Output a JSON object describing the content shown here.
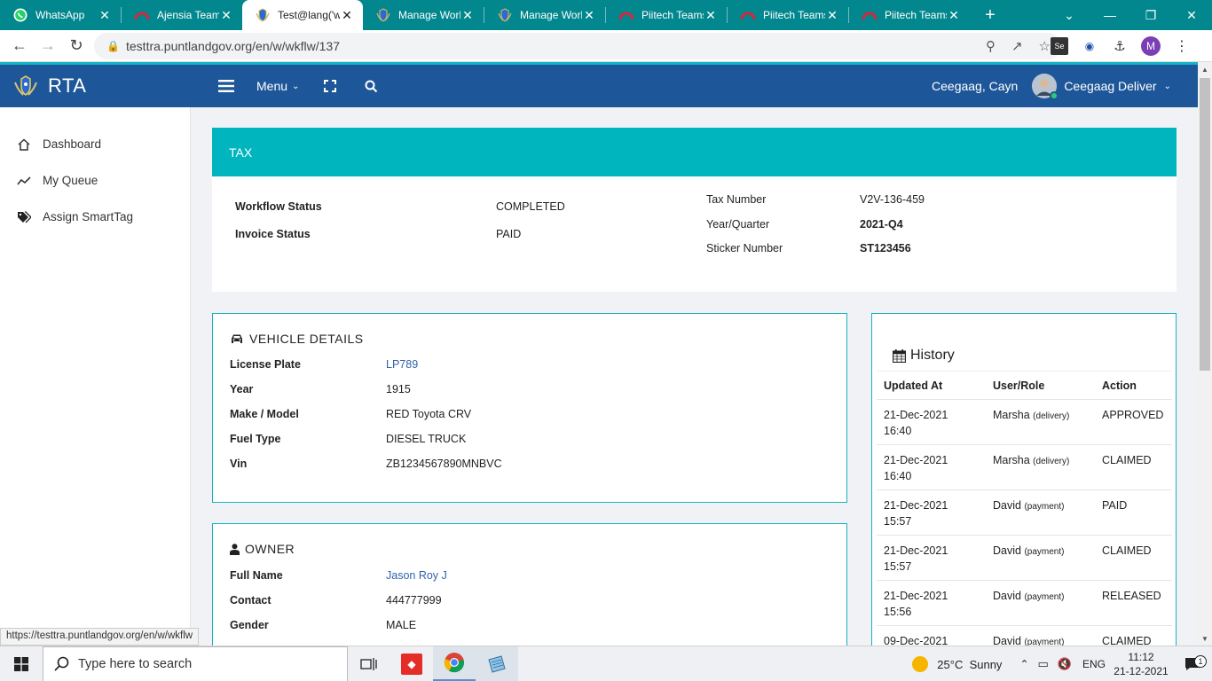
{
  "browser": {
    "tabs": [
      {
        "title": "WhatsApp",
        "favicon": "whatsapp-icon",
        "active": false
      },
      {
        "title": "Ajensia Team",
        "favicon": "teams-ring-icon",
        "active": false
      },
      {
        "title": "Test@lang('w",
        "favicon": "rta-crest-icon",
        "active": true
      },
      {
        "title": "Manage Worl",
        "favicon": "rta-crest-icon",
        "active": false
      },
      {
        "title": "Manage Worl",
        "favicon": "rta-crest-icon",
        "active": false
      },
      {
        "title": "Piitech Teams",
        "favicon": "teams-ring-icon",
        "active": false
      },
      {
        "title": "Piitech Teams",
        "favicon": "teams-ring-icon",
        "active": false
      },
      {
        "title": "Piitech Teams",
        "favicon": "teams-ring-icon",
        "active": false
      }
    ],
    "url": "testtra.puntlandgov.org/en/w/wkflw/137",
    "profile_initial": "M",
    "status_url": "https://testtra.puntlandgov.org/en/w/wkflw",
    "colors": {
      "tabbar": "#02878e",
      "header": "#1e5799",
      "accent": "#00b5bd"
    }
  },
  "header": {
    "brand": "RTA",
    "menu_label": "Menu",
    "user_short": "Ceegaag, Cayn",
    "user_role": "Ceegaag Deliver"
  },
  "sidebar": {
    "items": [
      {
        "label": "Dashboard",
        "icon": "home-icon"
      },
      {
        "label": "My Queue",
        "icon": "trend-line-icon"
      },
      {
        "label": "Assign SmartTag",
        "icon": "tags-icon"
      }
    ]
  },
  "tax": {
    "title": "TAX",
    "workflow_status_label": "Workflow Status",
    "workflow_status": "COMPLETED",
    "invoice_status_label": "Invoice Status",
    "invoice_status": "PAID",
    "tax_number_label": "Tax Number",
    "tax_number": "V2V-136-459",
    "year_quarter_label": "Year/Quarter",
    "year_quarter": "2021-Q4",
    "sticker_number_label": "Sticker Number",
    "sticker_number": "ST123456"
  },
  "vehicle": {
    "title": "VEHICLE DETAILS",
    "rows": [
      {
        "label": "License Plate",
        "value": "LP789"
      },
      {
        "label": "Year",
        "value": "1915"
      },
      {
        "label": "Make / Model",
        "value": "RED Toyota CRV"
      },
      {
        "label": "Fuel Type",
        "value": "DIESEL TRUCK"
      },
      {
        "label": "Vin",
        "value": "ZB1234567890MNBVC"
      }
    ]
  },
  "owner": {
    "title": "OWNER",
    "rows": [
      {
        "label": "Full Name",
        "value": "Jason Roy J"
      },
      {
        "label": "Contact",
        "value": "444777999"
      },
      {
        "label": "Gender",
        "value": "MALE"
      }
    ]
  },
  "history": {
    "title": "History",
    "columns": [
      "Updated At",
      "User/Role",
      "Action"
    ],
    "rows": [
      {
        "date": "21-Dec-2021",
        "time": "16:40",
        "user": "Marsha",
        "role": "(delivery)",
        "action": "APPROVED"
      },
      {
        "date": "21-Dec-2021",
        "time": "16:40",
        "user": "Marsha",
        "role": "(delivery)",
        "action": "CLAIMED"
      },
      {
        "date": "21-Dec-2021",
        "time": "15:57",
        "user": "David",
        "role": "(payment)",
        "action": "PAID"
      },
      {
        "date": "21-Dec-2021",
        "time": "15:57",
        "user": "David",
        "role": "(payment)",
        "action": "CLAIMED"
      },
      {
        "date": "21-Dec-2021",
        "time": "15:56",
        "user": "David",
        "role": "(payment)",
        "action": "RELEASED"
      },
      {
        "date": "09-Dec-2021",
        "time": "",
        "user": "David",
        "role": "(payment)",
        "action": "CLAIMED"
      }
    ]
  },
  "taskbar": {
    "search_placeholder": "Type here to search",
    "weather": "25°C  Sunny",
    "language": "ENG",
    "time": "11:12",
    "date": "21-12-2021",
    "notifications": "1"
  }
}
